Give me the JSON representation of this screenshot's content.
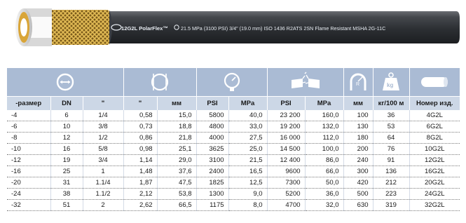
{
  "hose": {
    "brand": "12G2L PolarFlex™",
    "spec": "21.5 MPa (3100 PSI) 3/4\" (19.0 mm) ISO 1436 R2ATS 2SN Flame Resistant MSHA 2G-11C"
  },
  "icons": [
    {
      "name": "diameter-arrows-icon",
      "col": "size-dn"
    },
    {
      "name": "hose-section-icon",
      "col": "diameter"
    },
    {
      "name": "pressure-gauge-icon",
      "col": "working-pressure"
    },
    {
      "name": "burst-hose-icon",
      "col": "burst-pressure"
    },
    {
      "name": "bend-radius-icon",
      "col": "bend-radius"
    },
    {
      "name": "kg-weight-icon",
      "col": "weight"
    },
    {
      "name": "hose-part-icon",
      "col": "part-number"
    }
  ],
  "headers": [
    "-размер",
    "DN",
    "\"",
    "\"",
    "мм",
    "PSI",
    "MPa",
    "PSI",
    "MPa",
    "мм",
    "кг/100 м",
    "Номер изд."
  ],
  "rows": [
    [
      "-4",
      "6",
      "1/4",
      "0,58",
      "15,0",
      "5800",
      "40,0",
      "23 200",
      "160,0",
      "100",
      "36",
      "4G2L"
    ],
    [
      "-6",
      "10",
      "3/8",
      "0,73",
      "18,8",
      "4800",
      "33,0",
      "19 200",
      "132,0",
      "130",
      "53",
      "6G2L"
    ],
    [
      "-8",
      "12",
      "1/2",
      "0,86",
      "21,8",
      "4000",
      "27,5",
      "16 000",
      "112,0",
      "180",
      "64",
      "8G2L"
    ],
    [
      "-10",
      "16",
      "5/8",
      "0,98",
      "25,1",
      "3625",
      "25,0",
      "14 500",
      "100,0",
      "200",
      "76",
      "10G2L"
    ],
    [
      "-12",
      "19",
      "3/4",
      "1,14",
      "29,0",
      "3100",
      "21,5",
      "12 400",
      "86,0",
      "240",
      "91",
      "12G2L"
    ],
    [
      "-16",
      "25",
      "1",
      "1,48",
      "37,6",
      "2400",
      "16,5",
      "9600",
      "66,0",
      "300",
      "136",
      "16G2L"
    ],
    [
      "-20",
      "31",
      "1.1/4",
      "1,87",
      "47,5",
      "1825",
      "12,5",
      "7300",
      "50,0",
      "420",
      "212",
      "20G2L"
    ],
    [
      "-24",
      "38",
      "1.1/2",
      "2,12",
      "53,8",
      "1300",
      "9,0",
      "5200",
      "36,0",
      "500",
      "223",
      "24G2L"
    ],
    [
      "-32",
      "51",
      "2",
      "2,62",
      "66,5",
      "1175",
      "8,0",
      "4700",
      "32,0",
      "630",
      "319",
      "32G2L"
    ]
  ],
  "colors": {
    "icon_band": "#aabbd4",
    "header_band": "#ccd7e6",
    "hose_jacket": "#3a3d42"
  }
}
